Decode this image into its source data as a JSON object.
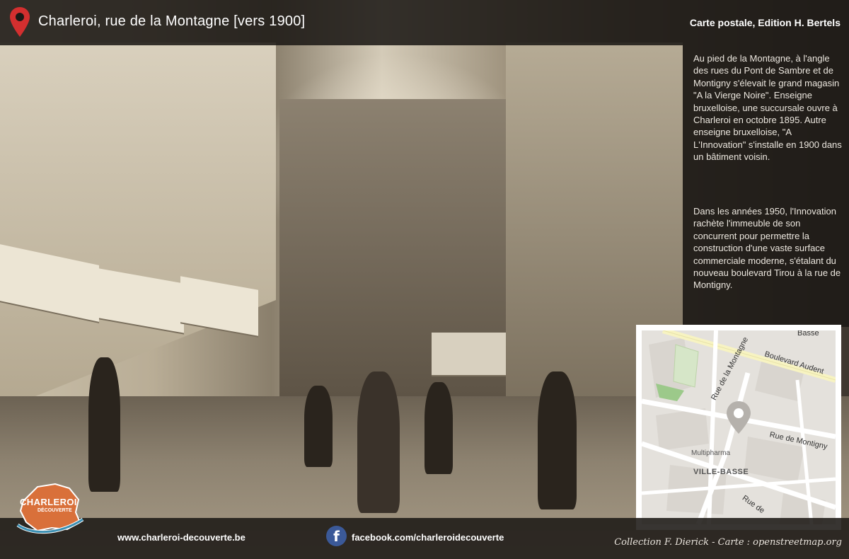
{
  "header": {
    "title": "Charleroi, rue de la Montagne [vers 1900]",
    "source": "Carte postale, Edition H. Bertels"
  },
  "description": {
    "paragraph_1": "Au pied de la Montagne, à l'angle des rues du Pont de Sambre et de Montigny s'élevait le grand magasin \"A la Vierge Noire\". Enseigne bruxelloise, une succursale ouvre à Charleroi en octobre 1895. Autre enseigne bruxelloise, \"A L'Innovation\" s'installe en 1900 dans un bâtiment voisin.",
    "paragraph_2": "Dans les années 1950, l'Innovation rachète l'immeuble de son concurrent pour permettre la construction d'une vaste surface commerciale moderne, s'étalant du nouveau boulevard Tirou à la rue de Montigny."
  },
  "map": {
    "labels": {
      "street_1": "Boulevard Audent",
      "street_2": "Rue de la Montagne",
      "street_3": "Rue de Montigny",
      "street_4": "Rue de",
      "street_5": "Basse",
      "district": "VILLE-BASSE",
      "poi": "Multipharma"
    }
  },
  "footer": {
    "website": "www.charleroi-decouverte.be",
    "facebook": "facebook.com/charleroidecouverte",
    "credit": "Collection F. Dierick - Carte : openstreetmap.org",
    "logo_main": "CHARLEROI",
    "logo_sub": "DÉCOUVERTE"
  },
  "icons": {
    "location": "map-pin-icon",
    "facebook": "facebook-icon"
  },
  "colors": {
    "pin": "#d32f2f",
    "facebook": "#3b5998",
    "overlay": "#1c1916"
  }
}
